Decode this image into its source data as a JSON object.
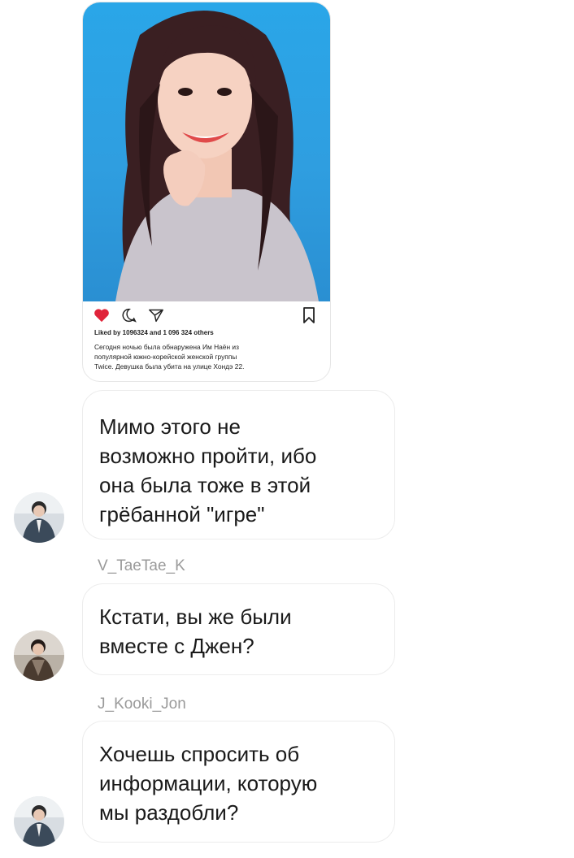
{
  "post": {
    "liked_by": "Liked by 1096324 and 1 096 324 others",
    "caption_lines": [
      "Сегодня ночью была обнаружена Им Наён из",
      "популярной южно-корейской женской группы",
      "Twice. Девушка была убита на улице Хондэ 22."
    ],
    "icons": [
      "heart-icon",
      "comment-icon",
      "send-icon",
      "bookmark-icon"
    ],
    "colors": {
      "heart": "#e0243a",
      "photo_bg": "#2aa6e8"
    }
  },
  "messages": [
    {
      "sender": "",
      "lines": [
        "Мимо этого не",
        "возможно пройти, ибо",
        "она была тоже в этой",
        "грёбанной \"игре\""
      ]
    },
    {
      "sender": "V_TaeTae_K",
      "lines": [
        "Кстати, вы же были",
        "вместе с Джен?"
      ]
    },
    {
      "sender": "J_Kooki_Jon",
      "lines": [
        "Хочешь спросить об",
        "информации, которую",
        "мы раздобли?"
      ]
    }
  ]
}
